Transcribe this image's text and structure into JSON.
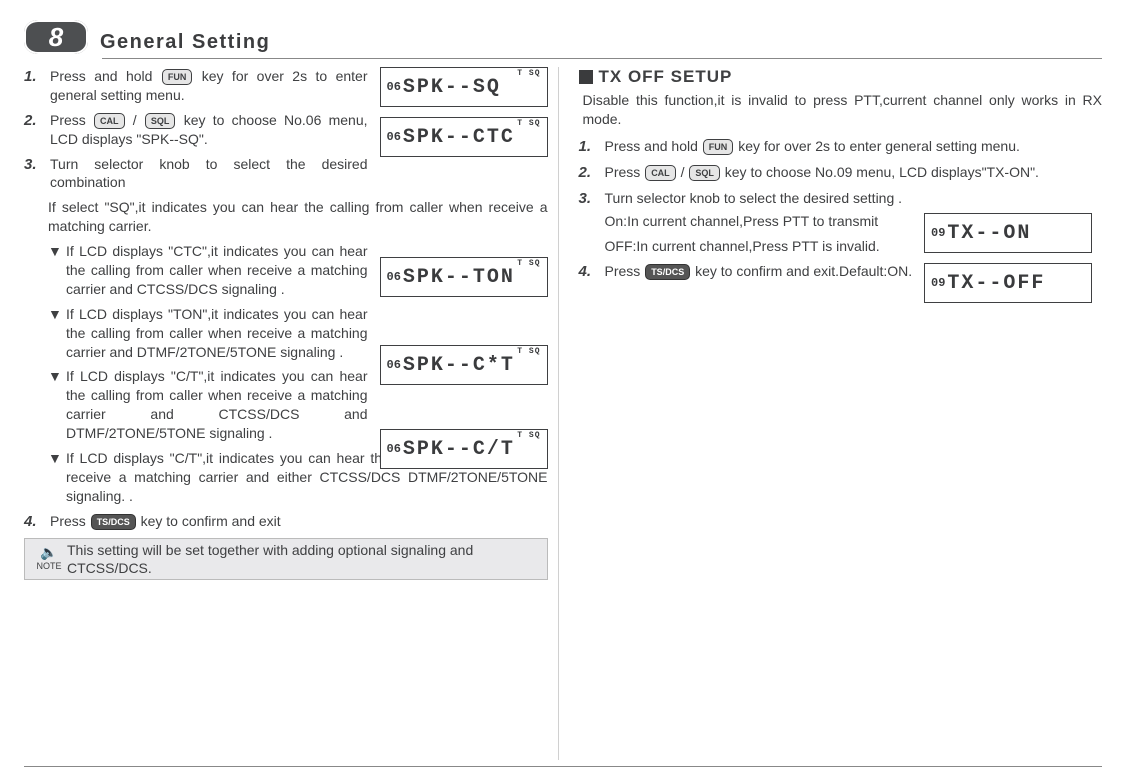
{
  "header": {
    "page_number": "8",
    "title": "General Setting"
  },
  "keys": {
    "fun": "FUN",
    "cal": "CAL",
    "sql": "SQL",
    "tsdcs": "TS/DCS"
  },
  "left": {
    "step1_a": "Press and hold ",
    "step1_b": " key for over 2s to enter general setting menu.",
    "step2_a": "Press ",
    "step2_slash": "/",
    "step2_b": " key  to choose No.06 menu, LCD displays \"SPK--SQ\".",
    "step3": "Turn selector knob to select the desired combination",
    "para_sq": "If select \"SQ\",it indicates you can hear the calling from caller when receive a matching carrier.",
    "b_ctc": "If LCD displays \"CTC\",it indicates you can hear the calling from caller when receive a matching carrier and CTCSS/DCS signaling .",
    "b_ton": "If LCD displays \"TON\",it indicates you can hear the calling from caller when receive a matching carrier and DTMF/2TONE/5TONE signaling .",
    "b_cstart": "If LCD displays \"C/T\",it indicates you can hear the calling from caller when receive a matching carrier and CTCSS/DCS and DTMF/2TONE/5TONE signaling .",
    "b_ct": "If LCD displays \"C/T\",it indicates you can hear the calling from caller when receive a matching carrier and either CTCSS/DCS DTMF/2TONE/5TONE signaling. .",
    "step4_a": "Press ",
    "step4_b": " key to confirm and exit",
    "note": "This setting will be set together with adding optional signaling and CTCSS/DCS.",
    "note_label": "NOTE"
  },
  "right": {
    "section_title": "TX OFF SETUP",
    "intro": "Disable this function,it is invalid to press PTT,current channel only works in RX mode.",
    "step1_a": "Press and hold ",
    "step1_b": " key for over 2s to enter general setting menu.",
    "step2_a": "Press ",
    "step2_slash": "/",
    "step2_b": " key to choose No.09 menu, LCD displays\"TX-ON\".",
    "step3": "Turn selector knob to select the desired setting .",
    "step3_on": "On:In current channel,Press PTT to transmit",
    "step3_off": "OFF:In current channel,Press PTT is invalid.",
    "step4_a": "Press ",
    "step4_b": " key to confirm and exit.Default:ON."
  },
  "lcds": {
    "l1_num": "06",
    "l1": "SPK--SQ",
    "l2_num": "06",
    "l2": "SPK--CTC",
    "l3_num": "06",
    "l3": "SPK--TON",
    "l4_num": "06",
    "l4": "SPK--C*T",
    "l5_num": "06",
    "l5": "SPK--C/T",
    "r1_num": "09",
    "r1": "TX--ON",
    "r2_num": "09",
    "r2": "TX--OFF",
    "tsq": "T SQ"
  },
  "nums": {
    "n1": "1.",
    "n2": "2.",
    "n3": "3.",
    "n4": "4."
  },
  "bullet_mark": "▼"
}
